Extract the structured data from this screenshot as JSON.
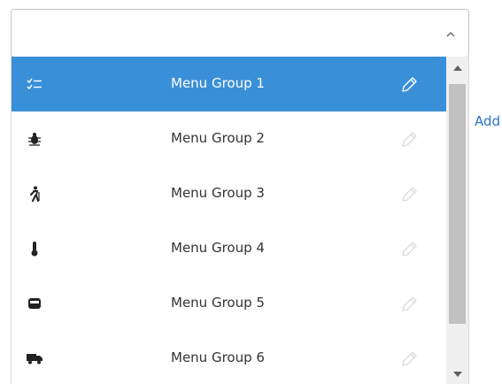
{
  "add_link_label": "Add",
  "colors": {
    "selected_row_bg": "#3a90d8",
    "link": "#2b73c4"
  },
  "menu": {
    "items": [
      {
        "label": "Menu Group 1",
        "icon": "checklist-icon",
        "selected": true
      },
      {
        "label": "Menu Group 2",
        "icon": "bug-icon",
        "selected": false
      },
      {
        "label": "Menu Group 3",
        "icon": "hiking-person-icon",
        "selected": false
      },
      {
        "label": "Menu Group 4",
        "icon": "thermometer-icon",
        "selected": false
      },
      {
        "label": "Menu Group 5",
        "icon": "inbox-tray-icon",
        "selected": false
      },
      {
        "label": "Menu Group 6",
        "icon": "truck-icon",
        "selected": false
      }
    ]
  }
}
